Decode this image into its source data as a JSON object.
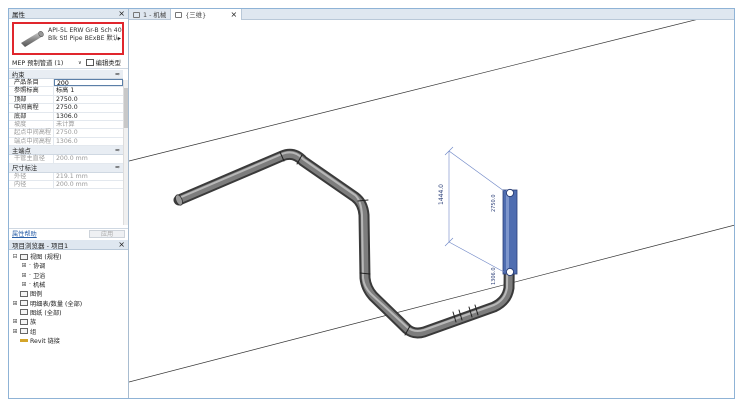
{
  "properties_panel": {
    "title": "属性",
    "type_name": "API-5L ERW Gr-B Sch 40 Blk Stl Pipe BExBE 默认",
    "type_selector": "MEP 预制管道 (1)",
    "edit_type": "编辑类型",
    "sections": [
      {
        "name": "约束",
        "rows": [
          {
            "key": "产品条目",
            "value": "200",
            "editing": true,
            "dim": false
          },
          {
            "key": "参照标高",
            "value": "标高 1",
            "editing": false,
            "dim": false
          },
          {
            "key": "顶部",
            "value": "2750.0",
            "editing": false,
            "dim": false
          },
          {
            "key": "中间高程",
            "value": "2750.0",
            "editing": false,
            "dim": false
          },
          {
            "key": "底部",
            "value": "1306.0",
            "editing": false,
            "dim": false
          },
          {
            "key": "坡度",
            "value": "未计算",
            "editing": false,
            "dim": true
          },
          {
            "key": "起点中间高程",
            "value": "2750.0",
            "editing": false,
            "dim": true
          },
          {
            "key": "端点中间高程",
            "value": "1306.0",
            "editing": false,
            "dim": true
          }
        ]
      },
      {
        "name": "主端点",
        "rows": [
          {
            "key": "干管主直径",
            "value": "200.0 mm",
            "editing": false,
            "dim": true
          }
        ]
      },
      {
        "name": "尺寸标注",
        "rows": [
          {
            "key": "外径",
            "value": "219.1 mm",
            "editing": false,
            "dim": true
          },
          {
            "key": "内径",
            "value": "200.0 mm",
            "editing": false,
            "dim": true
          }
        ]
      }
    ],
    "help_link": "属性帮助",
    "apply_button": "应用"
  },
  "project_browser": {
    "title": "项目浏览器 - 项目1",
    "nodes": [
      {
        "label": "视图 (规程)",
        "level": 0,
        "expander": "⊟",
        "icon": true
      },
      {
        "label": "协调",
        "level": 1,
        "expander": "⊞",
        "icon": false
      },
      {
        "label": "卫浴",
        "level": 1,
        "expander": "⊞",
        "icon": false
      },
      {
        "label": "机械",
        "level": 1,
        "expander": "⊞",
        "icon": false
      },
      {
        "label": "图例",
        "level": 0,
        "expander": "",
        "icon": true
      },
      {
        "label": "明细表/数量 (全部)",
        "level": 0,
        "expander": "⊞",
        "icon": true
      },
      {
        "label": "图纸 (全部)",
        "level": 0,
        "expander": "",
        "icon": true
      },
      {
        "label": "族",
        "level": 0,
        "expander": "⊞",
        "icon": true
      },
      {
        "label": "组",
        "level": 0,
        "expander": "⊞",
        "icon": true
      },
      {
        "label": "Revit 链接",
        "level": 0,
        "expander": "",
        "icon": "link"
      }
    ]
  },
  "tabs": [
    {
      "label": "1 - 机械",
      "active": false
    },
    {
      "label": "{三维}",
      "active": true
    }
  ],
  "viewport": {
    "dimension_label": "1444.0",
    "top_tag": "2750.0",
    "bottom_tag": "1306.0"
  },
  "colors": {
    "selection_blue": "#4f6db0",
    "pipe_dark": "#5a5a5a",
    "highlight_red": "#e0262d"
  }
}
